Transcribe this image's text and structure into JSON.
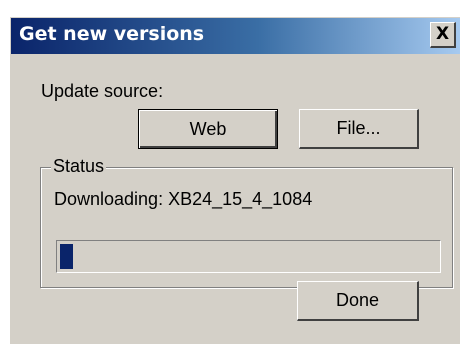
{
  "window": {
    "title": "Get new versions",
    "close_glyph": "X",
    "close_icon": "close-icon"
  },
  "update_source": {
    "label": "Update source:",
    "web_label": "Web",
    "file_label": "File..."
  },
  "status": {
    "legend": "Status",
    "message": "Downloading: XB24_15_4_1084",
    "progress_fraction": 0.035
  },
  "actions": {
    "done_label": "Done"
  },
  "colors": {
    "title_start": "#0a246a",
    "title_end": "#a6caf0",
    "face": "#d4d0c8",
    "progress_fill": "#0a246a"
  }
}
